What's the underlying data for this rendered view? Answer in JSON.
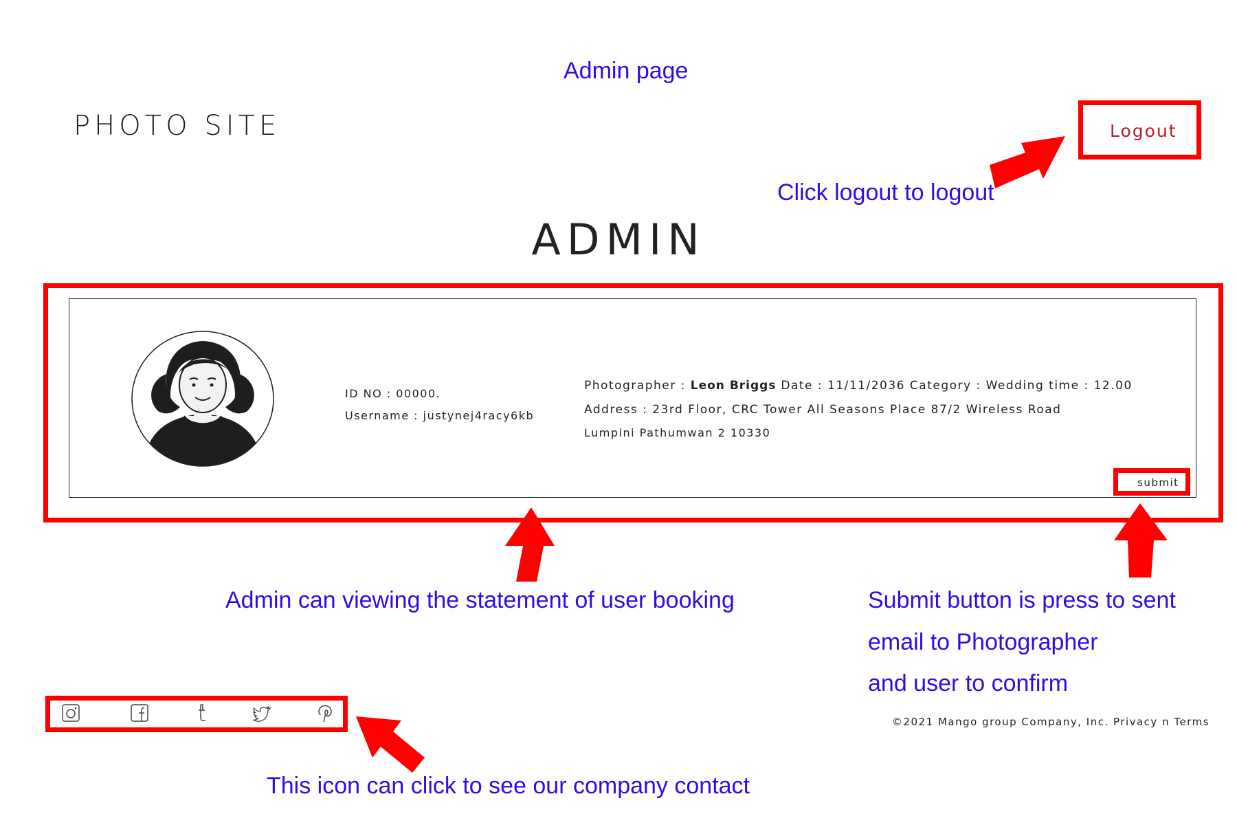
{
  "annotations": {
    "page_label": "Admin page",
    "logout_note": "Click logout to logout",
    "statement_note": "Admin can viewing the statement of user booking",
    "submit_note_line1": "Submit button is press to sent",
    "submit_note_line2": "email to Photographer",
    "submit_note_line3": "and user to confirm",
    "icons_note": "This icon can click to see our company contact"
  },
  "header": {
    "site_title": "PHOTO SITE",
    "logout_label": "Logout"
  },
  "main": {
    "heading": "ADMIN"
  },
  "booking": {
    "id_no": "ID NO : 00000.",
    "username": "Username : justynej4racy6kb",
    "photographer_label": "Photographer : ",
    "photographer_name": "Leon Briggs",
    "date": " Date : 11/11/2036",
    "category": " Category : Wedding",
    "time": " time : 12.00",
    "address_line1": "Address : 23rd Floor, CRC Tower All Seasons Place 87/2 Wireless Road",
    "address_line2": "Lumpini Pathumwan 2 10330",
    "submit_label": "submit"
  },
  "footer": {
    "social_icons": [
      "instagram-icon",
      "facebook-icon",
      "tumblr-icon",
      "twitter-icon",
      "pinterest-icon"
    ],
    "copyright": "©2021 Mango group Company, Inc. Privacy n Terms"
  },
  "colors": {
    "annotation_blue": "#2b0fe6",
    "highlight_red": "#ff0000",
    "logout_text": "#b0202a"
  }
}
